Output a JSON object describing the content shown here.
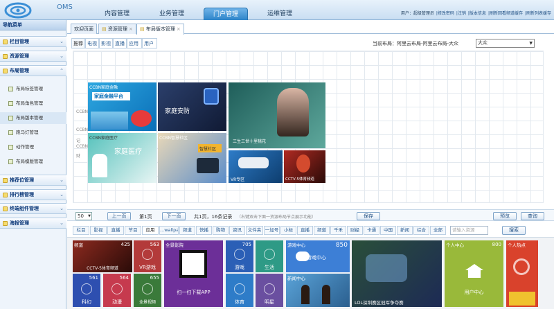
{
  "app": {
    "name": "OMS"
  },
  "header": {
    "tabs": [
      "内容管理",
      "业务管理",
      "门户管理",
      "运维管理"
    ],
    "active_tab": 2,
    "right_items": [
      "用户：超级管理员",
      "|修改密码",
      "|注销",
      "|版本信息",
      "|刷新回看频道缓存",
      "|刷新列表缓存"
    ]
  },
  "sidebar": {
    "title": "导航菜单",
    "sections": [
      "栏目管理",
      "资源管理",
      "布局管理",
      "推荐位管理",
      "排行榜管理",
      "终端组件管理",
      "海报管理"
    ],
    "sub_items": [
      "布局标签管理",
      "布局角色管理",
      "布局版本管理",
      "跑马灯管理",
      "动作管理",
      "布局模版管理"
    ],
    "active_sub": 2
  },
  "page_tabs": [
    {
      "label": "欢迎页面"
    },
    {
      "label": "资源管理"
    },
    {
      "label": "布局版本管理"
    }
  ],
  "content_tabs": [
    "推荐",
    "电视",
    "影视",
    "直播",
    "应用",
    "用户"
  ],
  "current_layout_label": "当前布局：阿里云布局-阿里云布局-大众",
  "layout_select": "大众",
  "grid_labels": [
    "CCBN",
    "CCBN",
    "CCBN",
    "CCBN",
    "记",
    "财"
  ],
  "grid_tiles": [
    {
      "text": "家庭金融平台",
      "sub": "CCBN家庭金融"
    },
    {
      "text": "家庭安防"
    },
    {
      "text": "三生三世十里桃花"
    },
    {
      "text": "家庭医疗",
      "sub": "CCBN家庭医疗"
    },
    {
      "text": "智慧社区",
      "sub": "CCBN智慧社区"
    },
    {
      "text": "VR专区"
    },
    {
      "text": "CCTV-5体育频道"
    }
  ],
  "pager": {
    "page_size": "50",
    "prev": "上一页",
    "page": "第1页",
    "next": "下一页",
    "total": "共1页，16条记录",
    "hint": "（右键双击下面一资源布局节点展示功能）",
    "save": "保存",
    "preview": "预览",
    "view": "查询"
  },
  "filters": [
    "栏目",
    "影视",
    "直播",
    "节目",
    "应用",
    "...wallpaper",
    "频道",
    "快播",
    "购物",
    "资讯",
    "文件夹",
    "一加号",
    "小标",
    "直播",
    "频道",
    "千禾",
    "财经",
    "卡通",
    "中国",
    "新闻",
    "综合",
    "全部"
  ],
  "active_filter": 4,
  "filter_search_placeholder": "请输入资源",
  "filter_search_button": "搜索",
  "bottom_tiles": [
    {
      "label": "频道",
      "num": "425",
      "cap": "CCTV-5体育频道"
    },
    {
      "label": "",
      "num": "563",
      "cap": "VR游戏"
    },
    {
      "label": "全景影院",
      "num": "",
      "cap": "扫一扫下载APP"
    },
    {
      "label": "",
      "num": "705",
      "cap": "游戏"
    },
    {
      "label": "",
      "num": "",
      "cap": "生活"
    },
    {
      "label": "游戏中心",
      "num": "850",
      "cap": "游戏中心"
    },
    {
      "label": "",
      "num": "",
      "cap": "LOL深圳赛区冠军争夺赛"
    },
    {
      "label": "个人中心",
      "num": "800",
      "cap": "用户中心"
    },
    {
      "label": "个人热点",
      "num": "",
      "cap": ""
    },
    {
      "label": "",
      "num": "561",
      "cap": "科幻"
    },
    {
      "label": "",
      "num": "564",
      "cap": "动漫"
    },
    {
      "label": "",
      "num": "655",
      "cap": "全景视频"
    },
    {
      "label": "",
      "num": "",
      "cap": "体育"
    },
    {
      "label": "",
      "num": "",
      "cap": "明星"
    },
    {
      "label": "新闻中心",
      "num": "",
      "cap": ""
    }
  ],
  "colors": {
    "header_bg": "#d7e7f6",
    "active_tab": "#2d84c9",
    "green": "#99b93a",
    "blue": "#3d7fd6"
  }
}
